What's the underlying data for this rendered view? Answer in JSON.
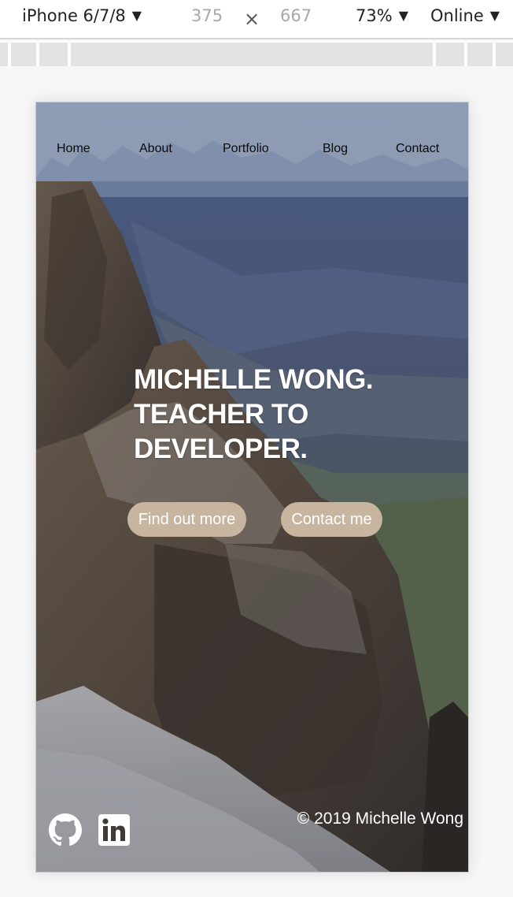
{
  "devtools": {
    "device": "iPhone 6/7/8",
    "width": "375",
    "times": "×",
    "height": "667",
    "zoom": "73%",
    "throttle": "Online",
    "caret": "▼"
  },
  "nav": {
    "links": [
      "Home",
      "About",
      "Portfolio",
      "Blog",
      "Contact"
    ]
  },
  "hero": {
    "headline": [
      "MICHELLE WONG.",
      "TEACHER TO",
      "DEVELOPER."
    ],
    "buttons": [
      "Find out more",
      "Contact me"
    ]
  },
  "footer": {
    "icons": [
      "github-icon",
      "linkedin-icon"
    ],
    "copyright": "© 2019 Michelle Wong"
  },
  "colors": {
    "button": "#c8b59f",
    "nav_overlay": "#9baac3",
    "text_light": "#ffffff"
  }
}
